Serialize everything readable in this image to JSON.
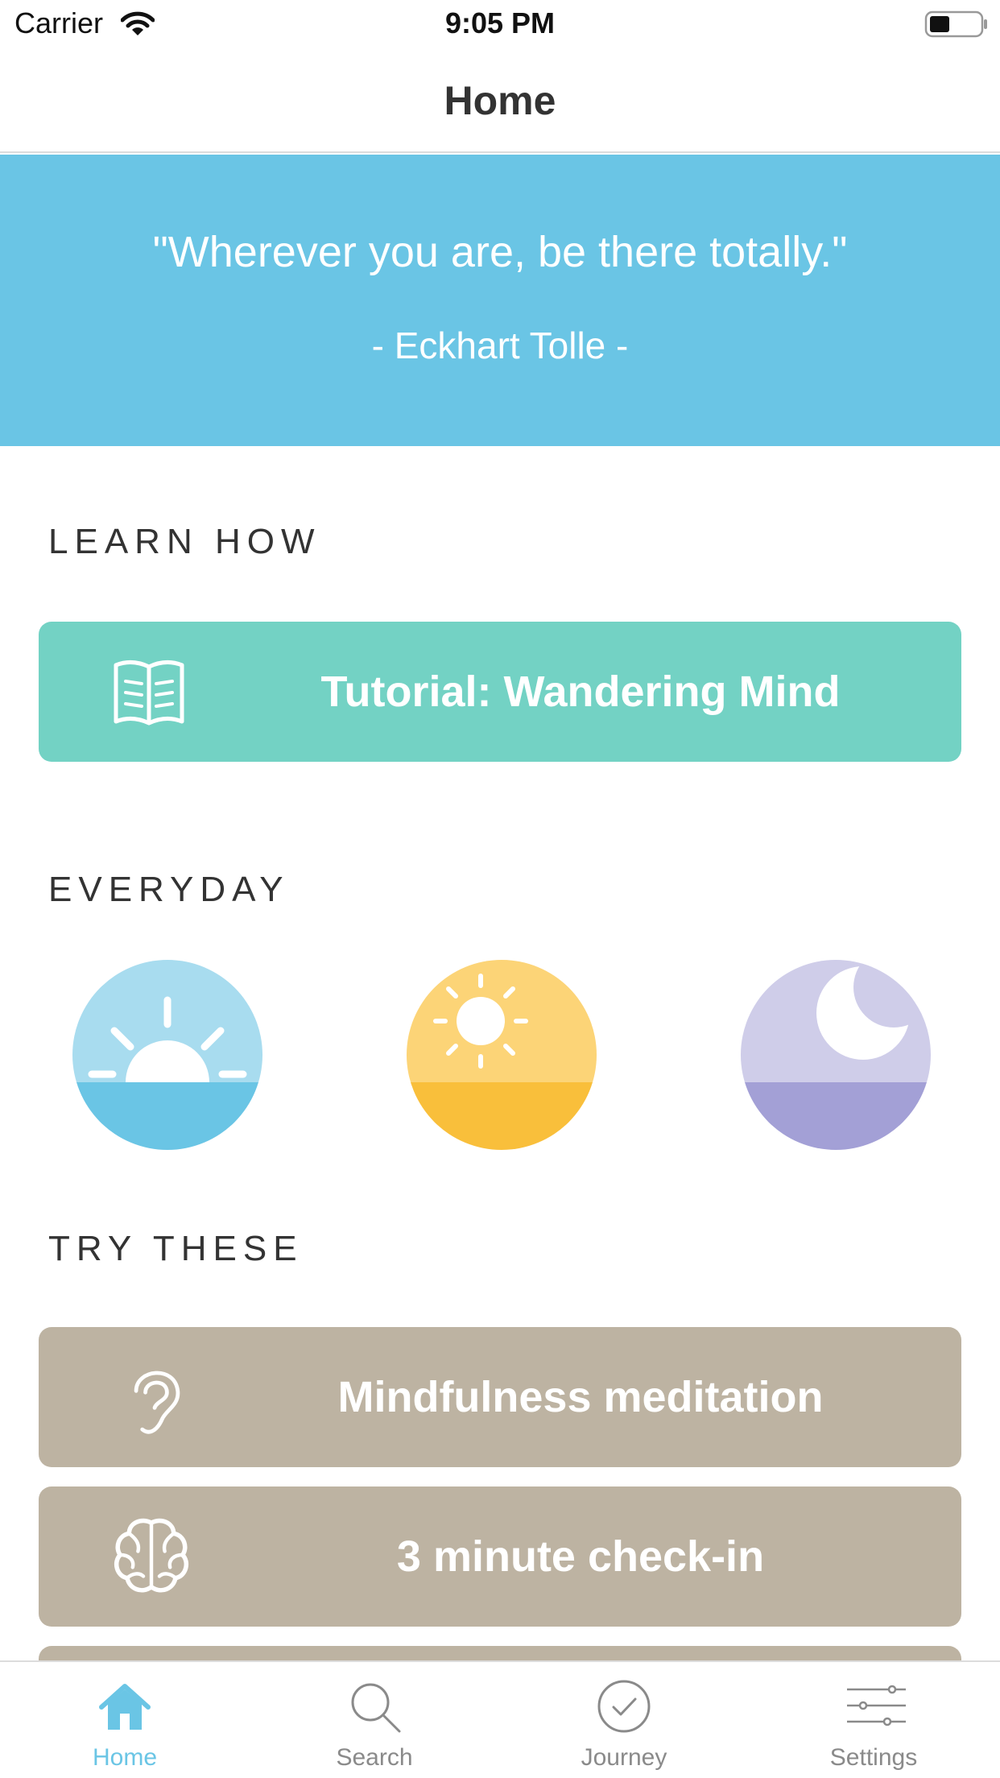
{
  "status_bar": {
    "carrier": "Carrier",
    "time": "9:05 PM"
  },
  "nav": {
    "title": "Home"
  },
  "quote": {
    "text": "\"Wherever you are, be there totally.\"",
    "author": "- Eckhart Tolle -"
  },
  "sections": {
    "learn_how": "LEARN HOW",
    "everyday": "EVERYDAY",
    "try_these": "TRY THESE"
  },
  "learn_how": {
    "tutorial_label": "Tutorial: Wandering Mind",
    "icon": "book-icon"
  },
  "everyday": {
    "items": [
      {
        "icon": "sunrise-icon"
      },
      {
        "icon": "sun-icon"
      },
      {
        "icon": "moon-icon"
      }
    ]
  },
  "try_these": {
    "items": [
      {
        "label": "Mindfulness meditation",
        "icon": "ear-icon"
      },
      {
        "label": "3 minute check-in",
        "icon": "brain-icon"
      }
    ]
  },
  "tab_bar": {
    "tabs": [
      {
        "label": "Home",
        "icon": "home-icon",
        "active": true
      },
      {
        "label": "Search",
        "icon": "search-icon"
      },
      {
        "label": "Journey",
        "icon": "checkmark-circle-icon"
      },
      {
        "label": "Settings",
        "icon": "sliders-icon"
      }
    ]
  },
  "colors": {
    "accent_blue": "#6ac5e5",
    "teal": "#73d2c4",
    "tan": "#bdb3a2",
    "sunrise_sky": "#a8dcef",
    "sunrise_water": "#6ac5e5",
    "sun_sky": "#fcd477",
    "sun_ground": "#f9bf3b",
    "moon_sky": "#cfcde9",
    "moon_ground": "#a3a0d6"
  }
}
